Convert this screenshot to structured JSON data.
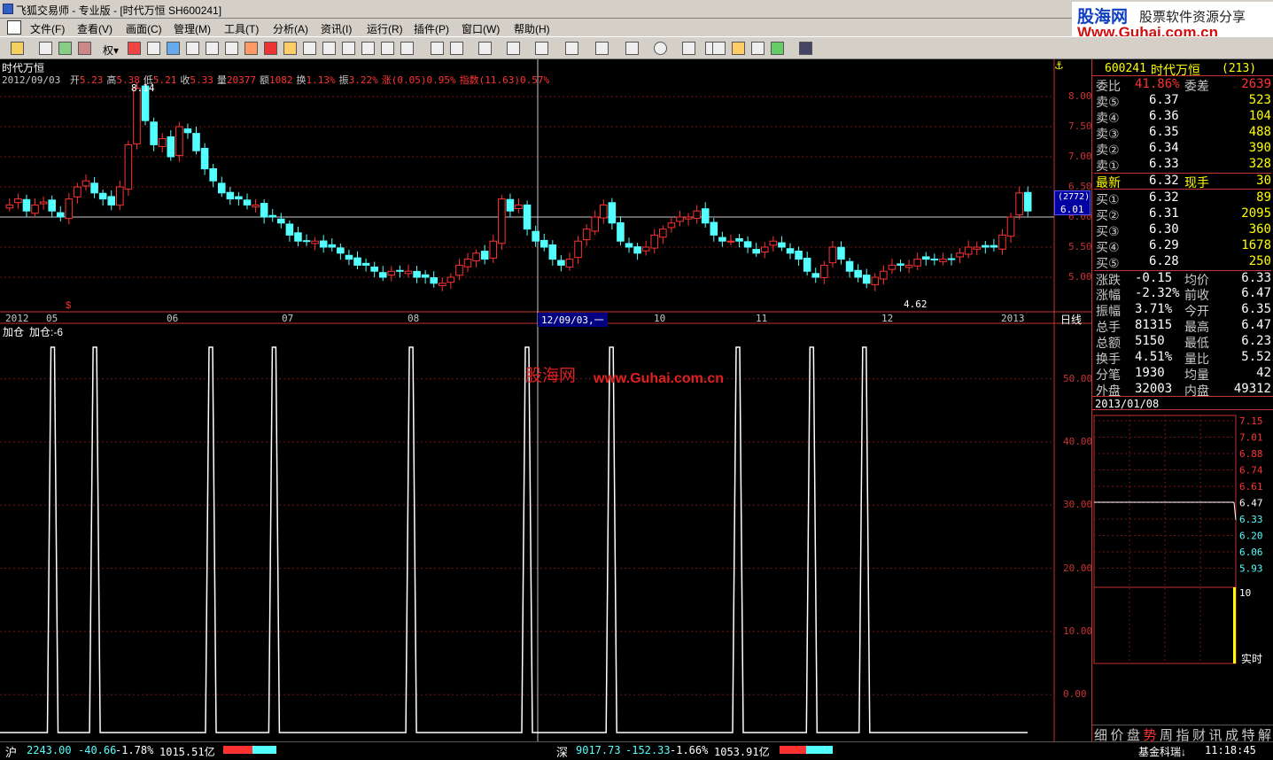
{
  "window": {
    "title": "飞狐交易师 - 专业版 - [时代万恒 SH600241]"
  },
  "logo": {
    "line1": "股海网",
    "line2": "股票软件资源分享",
    "url": "Www.Guhai.com.cn"
  },
  "menu": [
    "文件(F)",
    "查看(V)",
    "画面(C)",
    "管理(M)",
    "工具(T)",
    "分析(A)",
    "资讯(I)",
    "运行(R)",
    "插件(P)",
    "窗口(W)",
    "帮助(H)"
  ],
  "chart": {
    "stock_name": "时代万恒",
    "info_date": "2012/09/03",
    "info": [
      {
        "label": "开",
        "value": "5.23"
      },
      {
        "label": "高",
        "value": "5.38"
      },
      {
        "label": "低",
        "value": "5.21"
      },
      {
        "label": "收",
        "value": "5.33"
      },
      {
        "label": "量",
        "value": "20377"
      },
      {
        "label": "额",
        "value": "1082"
      },
      {
        "label": "换",
        "value": "1.13%"
      },
      {
        "label": "振",
        "value": "3.22%"
      },
      {
        "label": "涨",
        "value": "(0.05)0.95%"
      },
      {
        "label": "指数",
        "value": "(11.63)0.57%"
      }
    ],
    "price_ticks": [
      "8.00",
      "7.50",
      "7.00",
      "6.50",
      "6.00",
      "5.50",
      "5.00"
    ],
    "max_label": "8.14",
    "min_label": "4.62",
    "cursor_price_volume": "(2772)",
    "cursor_price": "6.01",
    "x_labels": [
      "2012",
      "05",
      "06",
      "07",
      "08",
      "12/09/03,一",
      "10",
      "11",
      "12",
      "2013"
    ],
    "period": "日线",
    "ind_title": "加仓",
    "ind_value_label": "加仓:-6",
    "ind_ticks": [
      "50.00",
      "40.00",
      "30.00",
      "20.00",
      "10.00",
      "0.00"
    ],
    "watermark_cn": "股海网",
    "watermark_url": "www.Guhai.com.cn",
    "dollar_mark": "$"
  },
  "chart_data": {
    "type": "candlestick",
    "ylim": [
      4.6,
      8.2
    ],
    "close_series": [
      6.2,
      6.3,
      6.1,
      6.2,
      6.25,
      6.1,
      6.0,
      6.3,
      6.5,
      6.6,
      6.4,
      6.3,
      6.2,
      6.5,
      7.2,
      8.14,
      7.6,
      7.2,
      7.3,
      7.0,
      7.5,
      7.4,
      7.1,
      6.8,
      6.6,
      6.4,
      6.3,
      6.3,
      6.2,
      6.2,
      6.0,
      6.0,
      5.9,
      5.7,
      5.6,
      5.6,
      5.6,
      5.5,
      5.5,
      5.4,
      5.3,
      5.2,
      5.2,
      5.1,
      5.0,
      5.1,
      5.1,
      5.1,
      5.0,
      5.0,
      4.9,
      4.9,
      5.0,
      5.2,
      5.3,
      5.4,
      5.3,
      5.6,
      6.3,
      6.1,
      6.2,
      5.8,
      5.6,
      5.5,
      5.3,
      5.2,
      5.3,
      5.6,
      5.8,
      6.0,
      6.2,
      5.9,
      5.6,
      5.5,
      5.4,
      5.5,
      5.7,
      5.8,
      5.9,
      6.0,
      6.0,
      6.1,
      5.9,
      5.7,
      5.6,
      5.6,
      5.6,
      5.5,
      5.4,
      5.5,
      5.6,
      5.5,
      5.4,
      5.3,
      5.1,
      5.0,
      5.2,
      5.5,
      5.3,
      5.1,
      5.0,
      4.9,
      5.0,
      5.1,
      5.2,
      5.2,
      5.2,
      5.3,
      5.3,
      5.3,
      5.3,
      5.3,
      5.4,
      5.5,
      5.5,
      5.5,
      5.5,
      5.7,
      6.0,
      6.4,
      6.1
    ],
    "indicator_spikes_x": [
      0.05,
      0.09,
      0.2,
      0.26,
      0.39,
      0.5,
      0.58,
      0.7,
      0.77,
      0.82
    ],
    "indicator_peak": 55,
    "indicator_base": -6,
    "intraday_date": "2013/01/08",
    "intraday_prices": [
      "7.15",
      "7.01",
      "6.88",
      "6.74",
      "6.61",
      "6.47",
      "6.33",
      "6.20",
      "6.06",
      "5.93"
    ],
    "intraday_vol_label": "10",
    "intraday_mode": "实时"
  },
  "quote": {
    "code": "600241",
    "name": "时代万恒",
    "count": "(213)",
    "weibi_label": "委比",
    "weibi": "41.86%",
    "weicha_label": "委差",
    "weicha": "2639",
    "sell": [
      {
        "label": "卖⑤",
        "price": "6.37",
        "vol": "523"
      },
      {
        "label": "卖④",
        "price": "6.36",
        "vol": "104"
      },
      {
        "label": "卖③",
        "price": "6.35",
        "vol": "488"
      },
      {
        "label": "卖②",
        "price": "6.34",
        "vol": "390"
      },
      {
        "label": "卖①",
        "price": "6.33",
        "vol": "328"
      }
    ],
    "last_label": "最新",
    "last": "6.32",
    "now_label": "现手",
    "now": "30",
    "buy": [
      {
        "label": "买①",
        "price": "6.32",
        "vol": "89"
      },
      {
        "label": "买②",
        "price": "6.31",
        "vol": "2095"
      },
      {
        "label": "买③",
        "price": "6.30",
        "vol": "360"
      },
      {
        "label": "买④",
        "price": "6.29",
        "vol": "1678"
      },
      {
        "label": "买⑤",
        "price": "6.28",
        "vol": "250"
      }
    ],
    "stats": [
      {
        "l1": "涨跌",
        "v1": "-0.15",
        "l2": "均价",
        "v2": "6.33"
      },
      {
        "l1": "涨幅",
        "v1": "-2.32%",
        "l2": "前收",
        "v2": "6.47"
      },
      {
        "l1": "振幅",
        "v1": "3.71%",
        "l2": "今开",
        "v2": "6.35"
      },
      {
        "l1": "总手",
        "v1": "81315",
        "l2": "最高",
        "v2": "6.47"
      },
      {
        "l1": "总额",
        "v1": "5150",
        "l2": "最低",
        "v2": "6.23"
      },
      {
        "l1": "换手",
        "v1": "4.51%",
        "l2": "量比",
        "v2": "5.52"
      },
      {
        "l1": "分笔",
        "v1": "1930",
        "l2": "均量",
        "v2": "42"
      },
      {
        "l1": "外盘",
        "v1": "32003",
        "l2": "内盘",
        "v2": "49312"
      }
    ],
    "tabs": [
      "细",
      "价",
      "盘",
      "势",
      "周",
      "指",
      "财",
      "讯",
      "成",
      "特",
      "解"
    ]
  },
  "status": {
    "sh_label": "沪",
    "sh_index": "2243.00",
    "sh_change": "-40.66",
    "sh_pct": "-1.78%",
    "sh_amount": "1015.51亿",
    "sz_label": "深",
    "sz_index": "9017.73",
    "sz_change": "-152.33",
    "sz_pct": "-1.66%",
    "sz_amount": "1053.91亿",
    "fund": "基金科瑞↓",
    "time": "11:18:45"
  },
  "colors": {
    "up": "#ff3232",
    "down": "#54ffff",
    "grid": "#7a1414",
    "axis": "#c83232",
    "yellow": "#ffff00"
  }
}
